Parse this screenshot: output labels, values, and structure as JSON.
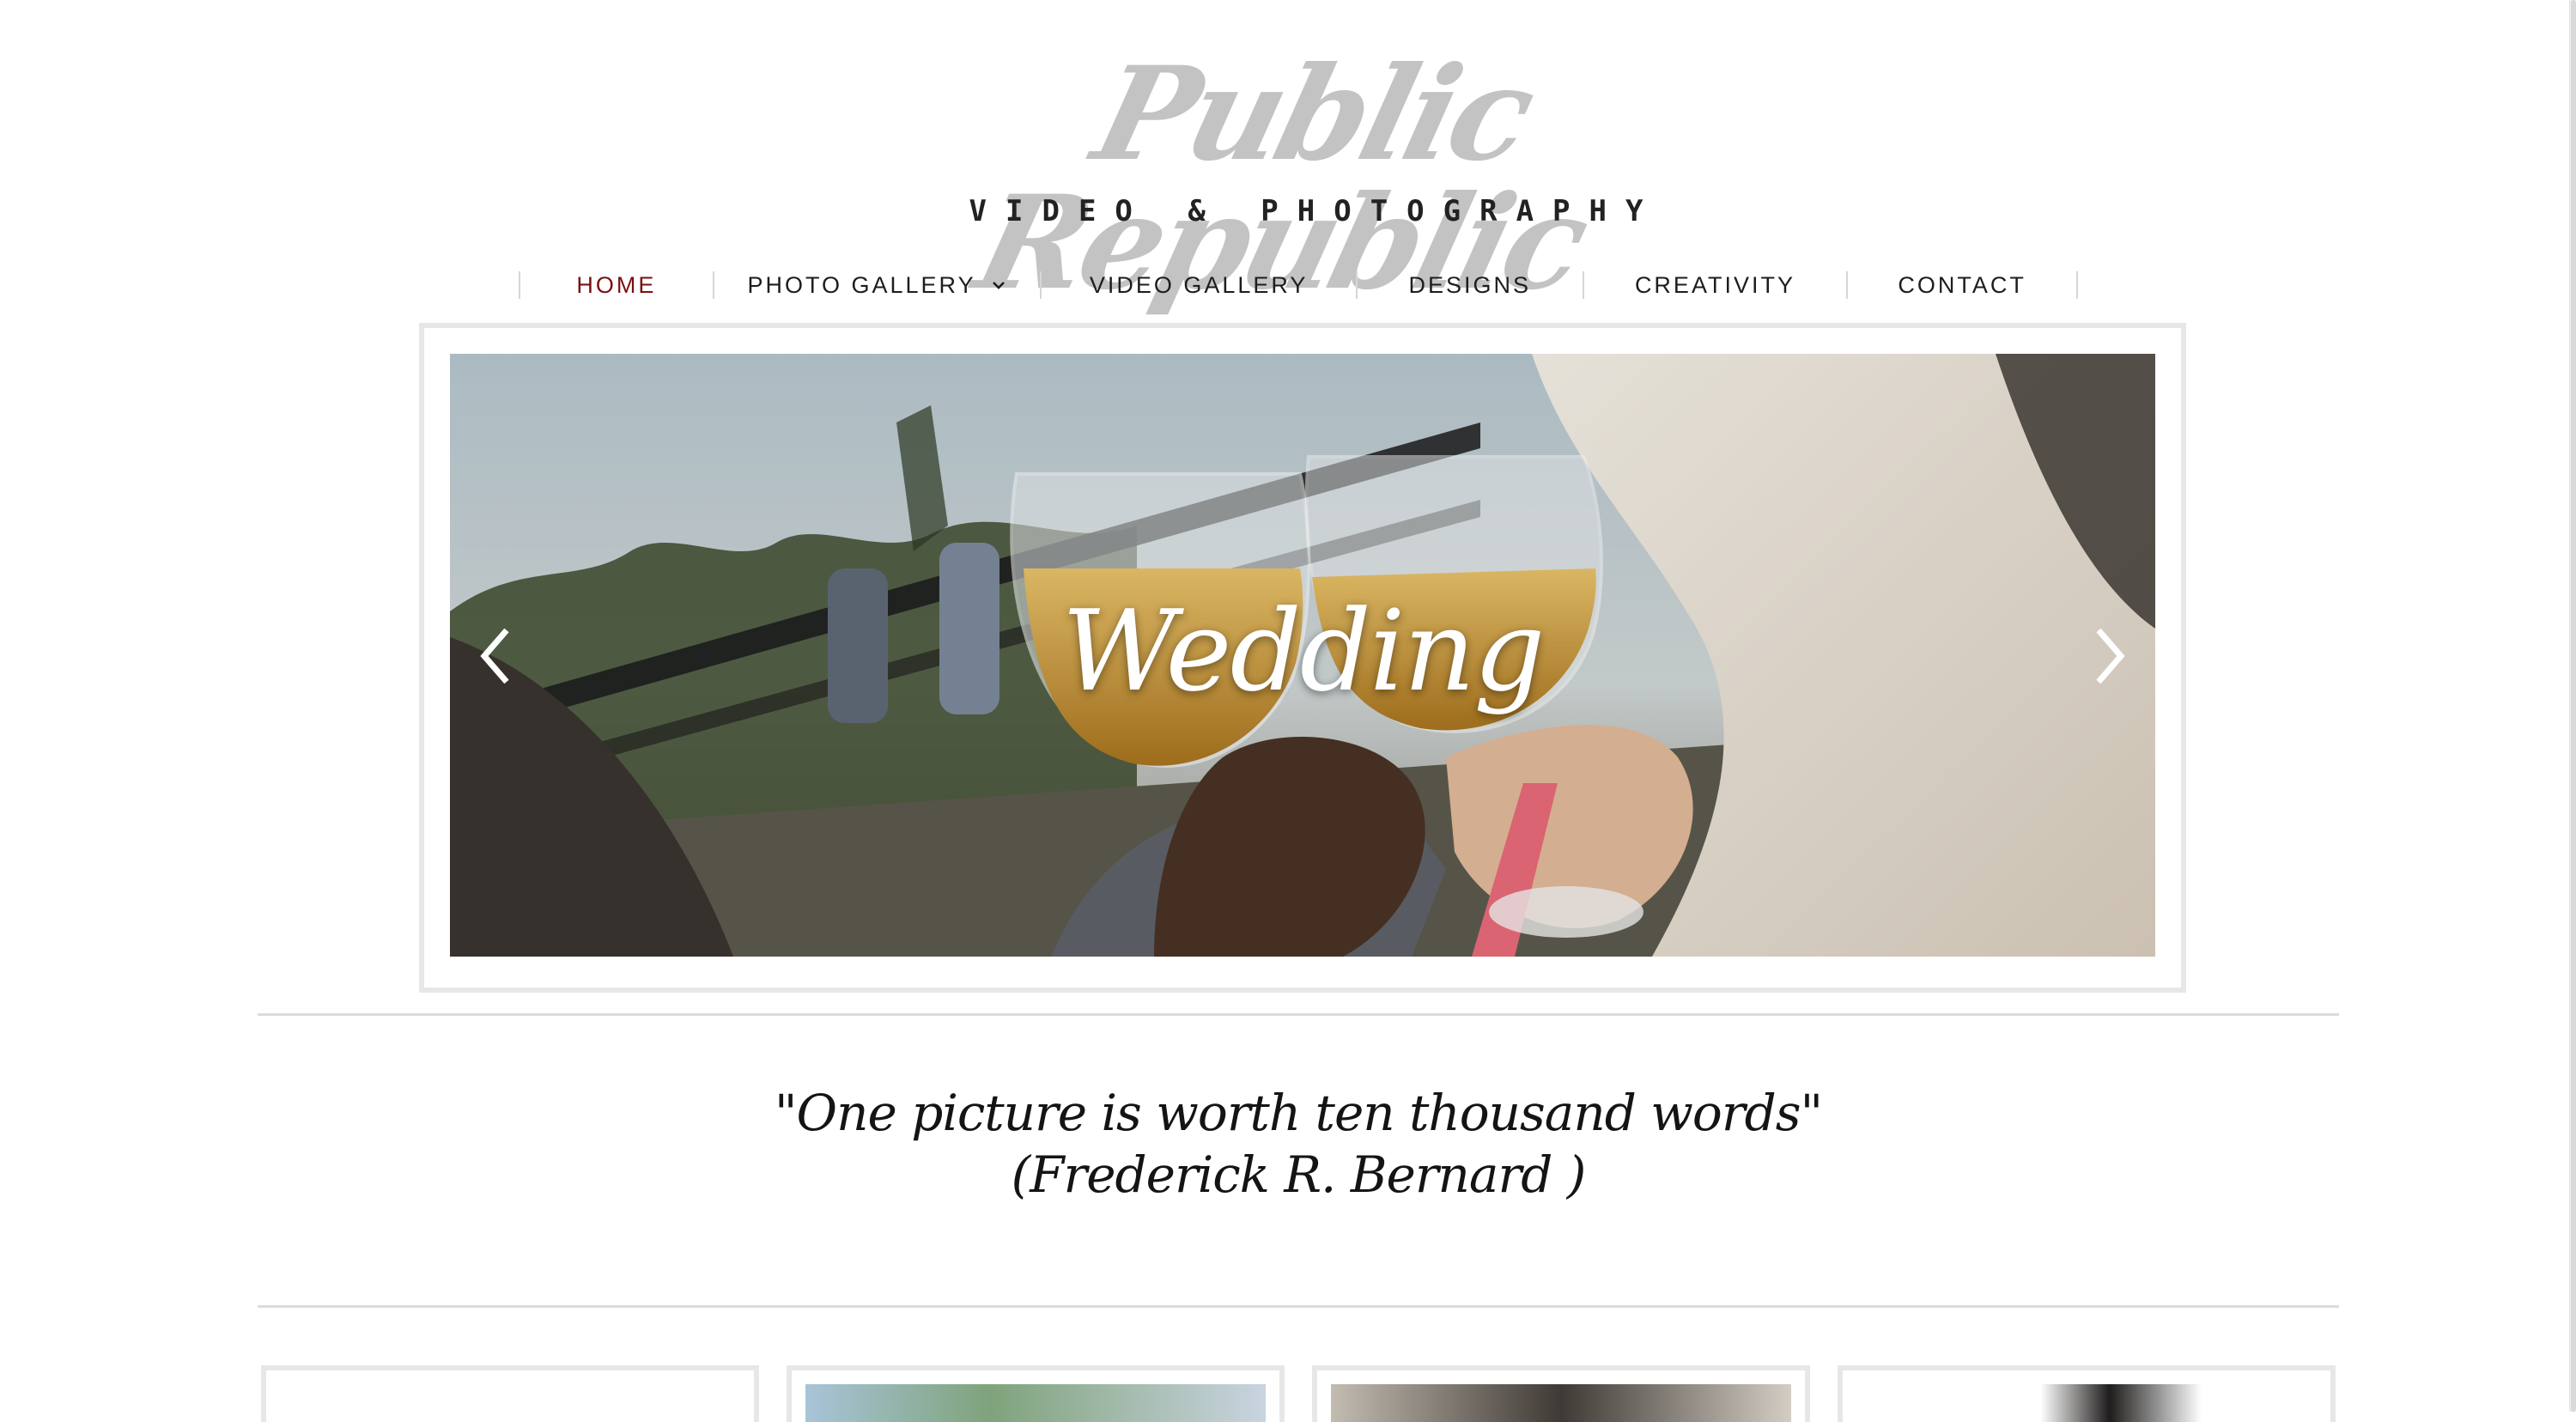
{
  "site": {
    "logo_script": "Public Republic",
    "logo_sub": "VIDEO & PHOTOGRAPHY"
  },
  "nav": {
    "items": [
      {
        "label": "HOME",
        "active": true
      },
      {
        "label": "PHOTO GALLERY",
        "has_dropdown": true
      },
      {
        "label": "VIDEO GALLERY"
      },
      {
        "label": "DESIGNS"
      },
      {
        "label": "CREATIVITY"
      },
      {
        "label": "CONTACT"
      }
    ],
    "active_color": "#7a0f12"
  },
  "slideshow": {
    "title": "Wedding",
    "prev_icon": "chevron-left-icon",
    "next_icon": "chevron-right-icon"
  },
  "quote": {
    "line1": "\"One picture is worth ten thousand words\"",
    "line2": "(Frederick R. Bernard )"
  },
  "gallery": {
    "thumbs": [
      "thumb-1",
      "thumb-2",
      "thumb-3",
      "thumb-4"
    ]
  }
}
